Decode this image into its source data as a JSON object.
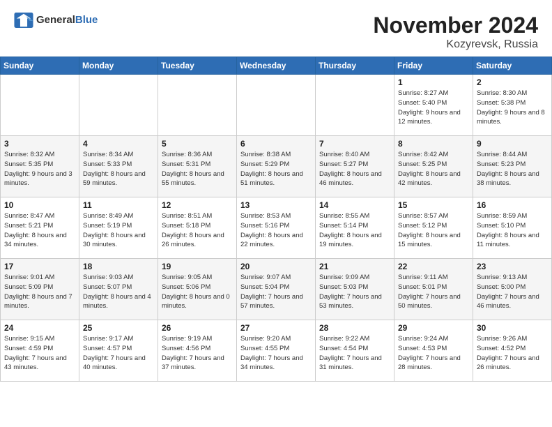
{
  "header": {
    "logo_general": "General",
    "logo_blue": "Blue",
    "month_year": "November 2024",
    "location": "Kozyrevsk, Russia"
  },
  "weekdays": [
    "Sunday",
    "Monday",
    "Tuesday",
    "Wednesday",
    "Thursday",
    "Friday",
    "Saturday"
  ],
  "weeks": [
    [
      {
        "day": "",
        "detail": ""
      },
      {
        "day": "",
        "detail": ""
      },
      {
        "day": "",
        "detail": ""
      },
      {
        "day": "",
        "detail": ""
      },
      {
        "day": "",
        "detail": ""
      },
      {
        "day": "1",
        "detail": "Sunrise: 8:27 AM\nSunset: 5:40 PM\nDaylight: 9 hours\nand 12 minutes."
      },
      {
        "day": "2",
        "detail": "Sunrise: 8:30 AM\nSunset: 5:38 PM\nDaylight: 9 hours\nand 8 minutes."
      }
    ],
    [
      {
        "day": "3",
        "detail": "Sunrise: 8:32 AM\nSunset: 5:35 PM\nDaylight: 9 hours\nand 3 minutes."
      },
      {
        "day": "4",
        "detail": "Sunrise: 8:34 AM\nSunset: 5:33 PM\nDaylight: 8 hours\nand 59 minutes."
      },
      {
        "day": "5",
        "detail": "Sunrise: 8:36 AM\nSunset: 5:31 PM\nDaylight: 8 hours\nand 55 minutes."
      },
      {
        "day": "6",
        "detail": "Sunrise: 8:38 AM\nSunset: 5:29 PM\nDaylight: 8 hours\nand 51 minutes."
      },
      {
        "day": "7",
        "detail": "Sunrise: 8:40 AM\nSunset: 5:27 PM\nDaylight: 8 hours\nand 46 minutes."
      },
      {
        "day": "8",
        "detail": "Sunrise: 8:42 AM\nSunset: 5:25 PM\nDaylight: 8 hours\nand 42 minutes."
      },
      {
        "day": "9",
        "detail": "Sunrise: 8:44 AM\nSunset: 5:23 PM\nDaylight: 8 hours\nand 38 minutes."
      }
    ],
    [
      {
        "day": "10",
        "detail": "Sunrise: 8:47 AM\nSunset: 5:21 PM\nDaylight: 8 hours\nand 34 minutes."
      },
      {
        "day": "11",
        "detail": "Sunrise: 8:49 AM\nSunset: 5:19 PM\nDaylight: 8 hours\nand 30 minutes."
      },
      {
        "day": "12",
        "detail": "Sunrise: 8:51 AM\nSunset: 5:18 PM\nDaylight: 8 hours\nand 26 minutes."
      },
      {
        "day": "13",
        "detail": "Sunrise: 8:53 AM\nSunset: 5:16 PM\nDaylight: 8 hours\nand 22 minutes."
      },
      {
        "day": "14",
        "detail": "Sunrise: 8:55 AM\nSunset: 5:14 PM\nDaylight: 8 hours\nand 19 minutes."
      },
      {
        "day": "15",
        "detail": "Sunrise: 8:57 AM\nSunset: 5:12 PM\nDaylight: 8 hours\nand 15 minutes."
      },
      {
        "day": "16",
        "detail": "Sunrise: 8:59 AM\nSunset: 5:10 PM\nDaylight: 8 hours\nand 11 minutes."
      }
    ],
    [
      {
        "day": "17",
        "detail": "Sunrise: 9:01 AM\nSunset: 5:09 PM\nDaylight: 8 hours\nand 7 minutes."
      },
      {
        "day": "18",
        "detail": "Sunrise: 9:03 AM\nSunset: 5:07 PM\nDaylight: 8 hours\nand 4 minutes."
      },
      {
        "day": "19",
        "detail": "Sunrise: 9:05 AM\nSunset: 5:06 PM\nDaylight: 8 hours\nand 0 minutes."
      },
      {
        "day": "20",
        "detail": "Sunrise: 9:07 AM\nSunset: 5:04 PM\nDaylight: 7 hours\nand 57 minutes."
      },
      {
        "day": "21",
        "detail": "Sunrise: 9:09 AM\nSunset: 5:03 PM\nDaylight: 7 hours\nand 53 minutes."
      },
      {
        "day": "22",
        "detail": "Sunrise: 9:11 AM\nSunset: 5:01 PM\nDaylight: 7 hours\nand 50 minutes."
      },
      {
        "day": "23",
        "detail": "Sunrise: 9:13 AM\nSunset: 5:00 PM\nDaylight: 7 hours\nand 46 minutes."
      }
    ],
    [
      {
        "day": "24",
        "detail": "Sunrise: 9:15 AM\nSunset: 4:59 PM\nDaylight: 7 hours\nand 43 minutes."
      },
      {
        "day": "25",
        "detail": "Sunrise: 9:17 AM\nSunset: 4:57 PM\nDaylight: 7 hours\nand 40 minutes."
      },
      {
        "day": "26",
        "detail": "Sunrise: 9:19 AM\nSunset: 4:56 PM\nDaylight: 7 hours\nand 37 minutes."
      },
      {
        "day": "27",
        "detail": "Sunrise: 9:20 AM\nSunset: 4:55 PM\nDaylight: 7 hours\nand 34 minutes."
      },
      {
        "day": "28",
        "detail": "Sunrise: 9:22 AM\nSunset: 4:54 PM\nDaylight: 7 hours\nand 31 minutes."
      },
      {
        "day": "29",
        "detail": "Sunrise: 9:24 AM\nSunset: 4:53 PM\nDaylight: 7 hours\nand 28 minutes."
      },
      {
        "day": "30",
        "detail": "Sunrise: 9:26 AM\nSunset: 4:52 PM\nDaylight: 7 hours\nand 26 minutes."
      }
    ]
  ]
}
